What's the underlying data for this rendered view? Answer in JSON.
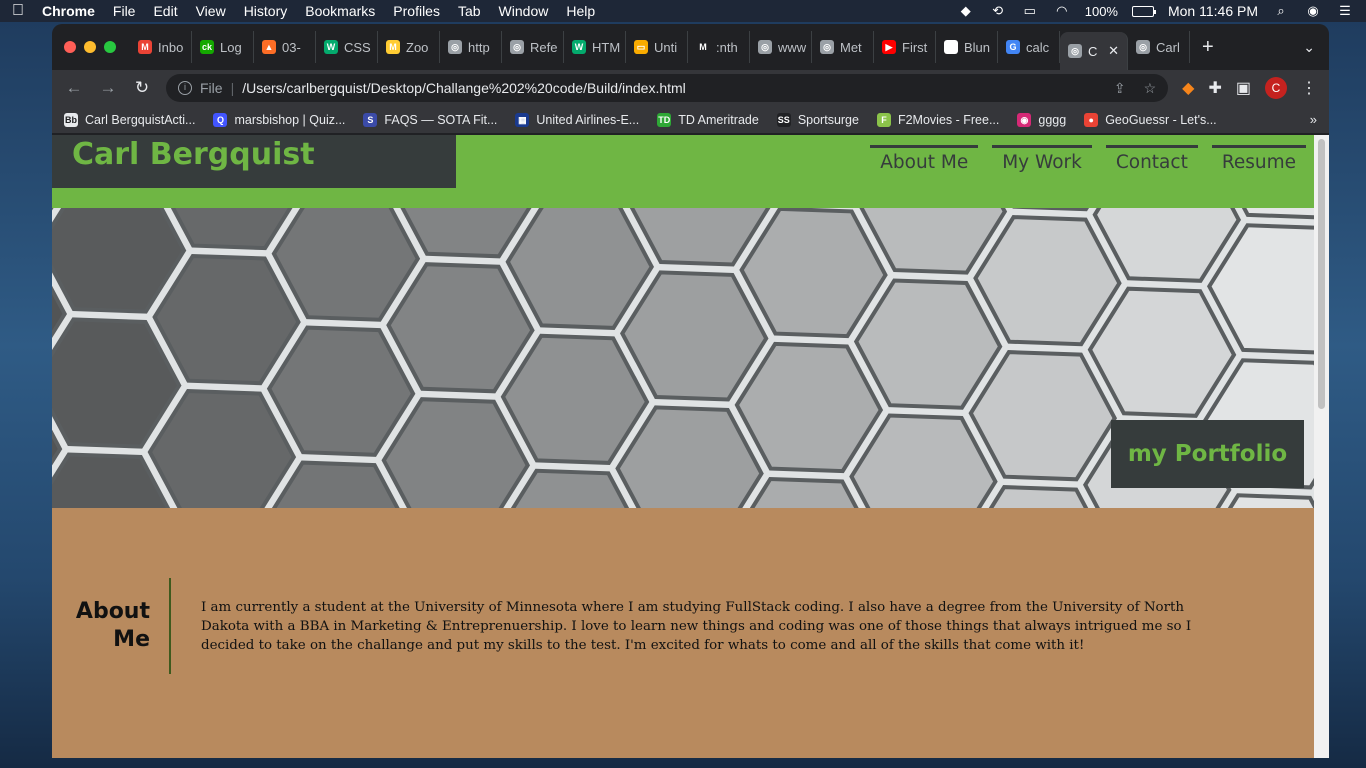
{
  "menubar": {
    "app_name": "Chrome",
    "items": [
      "File",
      "Edit",
      "View",
      "History",
      "Bookmarks",
      "Profiles",
      "Tab",
      "Window",
      "Help"
    ],
    "battery": "100%",
    "clock": "Mon 11:46 PM"
  },
  "tabs": [
    {
      "label": "Inbo",
      "favicon": "gmail-icon",
      "color": "#ea4335",
      "glyph": "M"
    },
    {
      "label": "Log",
      "favicon": "ck-icon",
      "color": "#14a800",
      "glyph": "ck"
    },
    {
      "label": "03-",
      "favicon": "gitlab-icon",
      "color": "#fc6d26",
      "glyph": "▲"
    },
    {
      "label": "CSS",
      "favicon": "w3-icon",
      "color": "#04aa6d",
      "glyph": "W"
    },
    {
      "label": "Zoo",
      "favicon": "umn-icon",
      "color": "#ffcc33",
      "glyph": "M"
    },
    {
      "label": "http",
      "favicon": "globe-icon",
      "color": "#9aa0a6",
      "glyph": "◎"
    },
    {
      "label": "Refe",
      "favicon": "globe-icon",
      "color": "#9aa0a6",
      "glyph": "◎"
    },
    {
      "label": "HTM",
      "favicon": "w3-icon",
      "color": "#04aa6d",
      "glyph": "W"
    },
    {
      "label": "Unti",
      "favicon": "doc-icon",
      "color": "#f9ab00",
      "glyph": "▭"
    },
    {
      "label": ":nth",
      "favicon": "mdn-icon",
      "color": "#202124",
      "glyph": "M"
    },
    {
      "label": "www",
      "favicon": "globe-icon",
      "color": "#9aa0a6",
      "glyph": "◎"
    },
    {
      "label": "Met",
      "favicon": "globe-icon",
      "color": "#9aa0a6",
      "glyph": "◎"
    },
    {
      "label": "First",
      "favicon": "youtube-icon",
      "color": "#ff0000",
      "glyph": "▶"
    },
    {
      "label": "Blun",
      "favicon": "wikipedia-icon",
      "color": "#ffffff",
      "glyph": "W"
    },
    {
      "label": "calc",
      "favicon": "google-icon",
      "color": "#4285f4",
      "glyph": "G"
    },
    {
      "label": "C",
      "favicon": "globe-icon",
      "color": "#9aa0a6",
      "glyph": "◎",
      "active": true
    },
    {
      "label": "Carl",
      "favicon": "globe-icon",
      "color": "#9aa0a6",
      "glyph": "◎"
    }
  ],
  "toolbar": {
    "scheme": "File",
    "url": "/Users/carlbergquist/Desktop/Challange%202%20code/Build/index.html",
    "profile_initial": "C"
  },
  "bookmarks": [
    {
      "label": "Carl BergquistActi...",
      "icon": "blackboard-icon",
      "color": "#e8eaed",
      "glyph": "Bb"
    },
    {
      "label": "marsbishop | Quiz...",
      "icon": "quizlet-icon",
      "color": "#4255ff",
      "glyph": "Q"
    },
    {
      "label": "FAQS — SOTA Fit...",
      "icon": "sota-icon",
      "color": "#3b4ba8",
      "glyph": "S"
    },
    {
      "label": "United Airlines-E...",
      "icon": "united-icon",
      "color": "#1a3a8f",
      "glyph": "▦"
    },
    {
      "label": "TD Ameritrade",
      "icon": "td-icon",
      "color": "#2ea836",
      "glyph": "TD"
    },
    {
      "label": "Sportsurge",
      "icon": "sportsurge-icon",
      "color": "#202124",
      "glyph": "SS"
    },
    {
      "label": "F2Movies - Free...",
      "icon": "f2movies-icon",
      "color": "#8bc34a",
      "glyph": "F"
    },
    {
      "label": "gggg",
      "icon": "instagram-icon",
      "color": "#d62976",
      "glyph": "◉"
    },
    {
      "label": "GeoGuessr - Let's...",
      "icon": "map-pin-icon",
      "color": "#ea4335",
      "glyph": "●"
    }
  ],
  "site": {
    "logo": "Carl Bergquist",
    "nav": [
      "About Me",
      "My Work",
      "Contact",
      "Resume"
    ],
    "hero_badge": "my Portfolio",
    "about_heading_line1": "About",
    "about_heading_line2": "Me",
    "about_text": "I am currently a student at the University of Minnesota where I am studying FullStack coding. I also have a degree from the University of North Dakota with a BBA in Marketing & Entreprenuership. I love to learn new things and coding was one of those things that always intrigued me so I decided to take on the challange and put my skills to the test. I'm excited for whats to come and all of the skills that come with it!"
  },
  "colors": {
    "brand_green": "#6fb644",
    "dark_slate": "#363c3c",
    "about_bg": "#b88a5e"
  }
}
